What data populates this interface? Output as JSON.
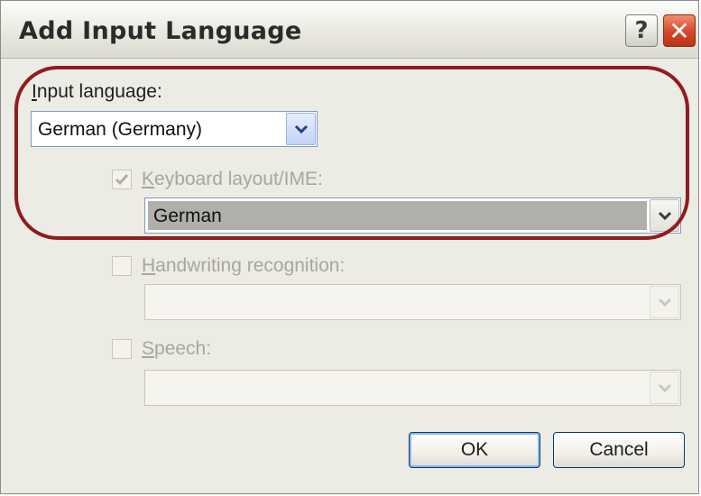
{
  "window": {
    "title": "Add Input Language",
    "help_glyph": "?",
    "close_glyph": "✕"
  },
  "input_language": {
    "label_u": "I",
    "label_rest": "nput language:",
    "value": "German (Germany)"
  },
  "keyboard_layout": {
    "label_u": "K",
    "label_rest": "eyboard layout/IME:",
    "checked": true,
    "value": "German"
  },
  "handwriting": {
    "label_u": "H",
    "label_rest": "andwriting recognition:",
    "checked": false,
    "value": ""
  },
  "speech": {
    "label_u": "S",
    "label_rest": "peech:",
    "checked": false,
    "value": ""
  },
  "buttons": {
    "ok_label": "OK",
    "cancel_label": "Cancel"
  },
  "colors": {
    "highlight_ring": "#8f1c20",
    "dialog_bg": "#ecebe4"
  }
}
